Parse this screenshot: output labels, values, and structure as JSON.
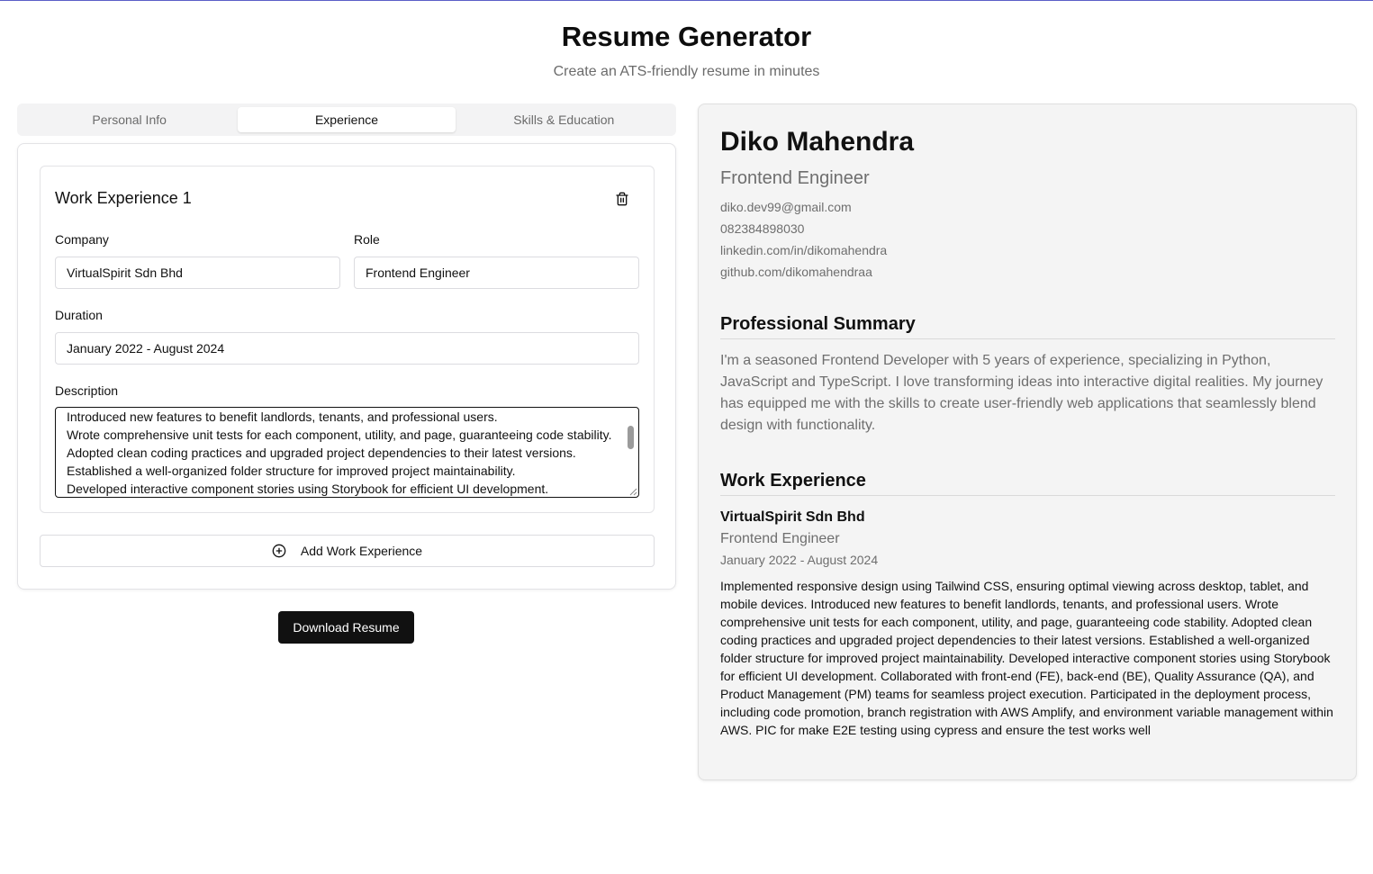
{
  "header": {
    "title": "Resume Generator",
    "subtitle": "Create an ATS-friendly resume in minutes"
  },
  "tabs": [
    {
      "label": "Personal Info",
      "active": false
    },
    {
      "label": "Experience",
      "active": true
    },
    {
      "label": "Skills & Education",
      "active": false
    }
  ],
  "editor": {
    "card_title": "Work Experience 1",
    "company_label": "Company",
    "company_value": "VirtualSpirit Sdn Bhd",
    "role_label": "Role",
    "role_value": "Frontend Engineer",
    "duration_label": "Duration",
    "duration_value": "January 2022 - August 2024",
    "description_label": "Description",
    "description_visible_lines": [
      "Introduced new features to benefit landlords, tenants, and professional users.",
      "Wrote comprehensive unit tests for each component, utility, and page, guaranteeing code stability.",
      "Adopted clean coding practices and upgraded project dependencies to their latest versions.",
      "Established a well-organized folder structure for improved project maintainability.",
      "Developed interactive component stories using Storybook for efficient UI development."
    ],
    "add_button_label": "Add Work Experience",
    "icons": {
      "delete": "trash-icon",
      "add": "plus-circle-icon"
    }
  },
  "download_button_label": "Download Resume",
  "preview": {
    "name": "Diko Mahendra",
    "title": "Frontend Engineer",
    "contacts": [
      "diko.dev99@gmail.com",
      "082384898030",
      "linkedin.com/in/dikomahendra",
      "github.com/dikomahendraa"
    ],
    "summary_heading": "Professional Summary",
    "summary": "I'm a seasoned Frontend Developer with 5 years of experience, specializing in Python, JavaScript and TypeScript. I love transforming ideas into interactive digital realities. My journey has equipped me with the skills to create user-friendly web applications that seamlessly blend design with functionality.",
    "experience_heading": "Work Experience",
    "experience": {
      "company": "VirtualSpirit Sdn Bhd",
      "role": "Frontend Engineer",
      "duration": "January 2022 - August 2024",
      "description": "Implemented responsive design using Tailwind CSS, ensuring optimal viewing across desktop, tablet, and mobile devices. Introduced new features to benefit landlords, tenants, and professional users. Wrote comprehensive unit tests for each component, utility, and page, guaranteeing code stability. Adopted clean coding practices and upgraded project dependencies to their latest versions. Established a well-organized folder structure for improved project maintainability. Developed interactive component stories using Storybook for efficient UI development. Collaborated with front-end (FE), back-end (BE), Quality Assurance (QA), and Product Management (PM) teams for seamless project execution. Participated in the deployment process, including code promotion, branch registration with AWS Amplify, and environment variable management within AWS. PIC for make E2E testing using cypress and ensure the test works well"
    }
  },
  "colors": {
    "accent_rule": "#5b5fc7",
    "primary_button": "#111111",
    "muted_text": "#6e6e6e",
    "preview_bg": "#f4f4f4"
  }
}
